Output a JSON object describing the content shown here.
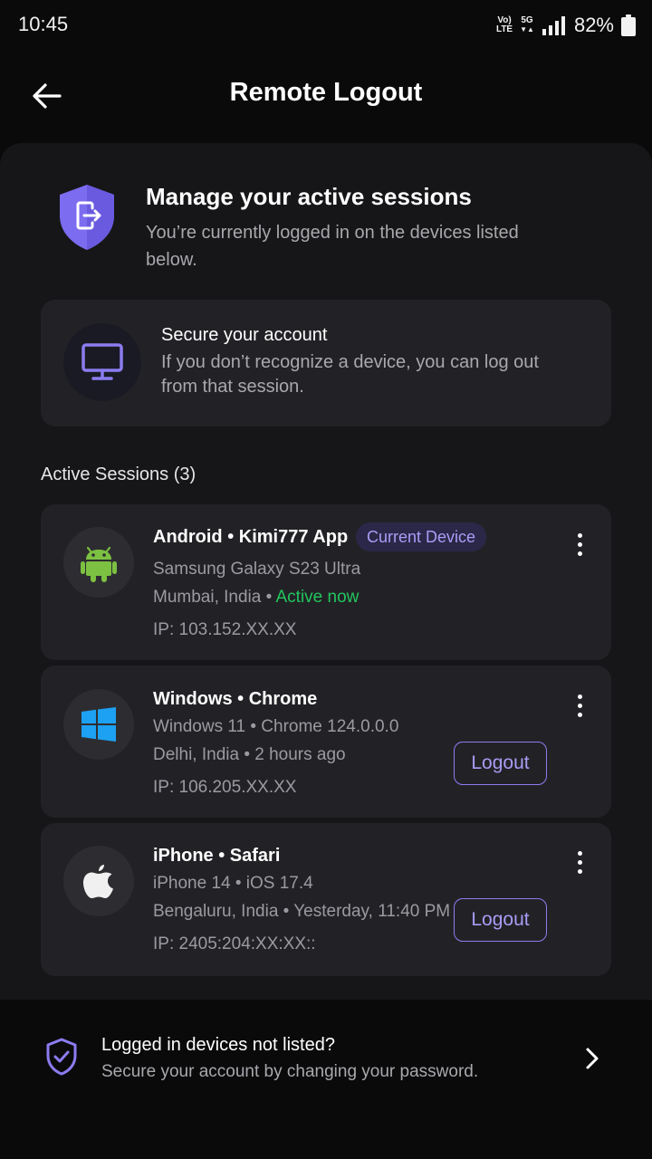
{
  "status_bar": {
    "time": "10:45",
    "volte_top": "Vo)",
    "volte_bottom": "LTE",
    "network": "5G",
    "battery": "82%"
  },
  "header": {
    "title": "Remote Logout"
  },
  "intro": {
    "title": "Manage your active sessions",
    "subtitle": "You’re currently logged in on the devices listed below."
  },
  "secure_card": {
    "title": "Secure your account",
    "text": "If you don’t recognize a device, you can log out from that session."
  },
  "sessions_label": "Active Sessions (3)",
  "sessions": [
    {
      "title": "Android • Kimi777 App",
      "badge": "Current Device",
      "device": "Samsung Galaxy S23 Ultra",
      "location": "Mumbai, India • ",
      "status": "Active now",
      "ip": "IP: 103.152.XX.XX",
      "icon": "android-icon"
    },
    {
      "title": "Windows • Chrome",
      "device": "Windows 11 • Chrome 124.0.0.0",
      "location": "Delhi, India • 2 hours ago",
      "ip": "IP: 106.205.XX.XX",
      "logout": "Logout",
      "icon": "windows-icon"
    },
    {
      "title": "iPhone • Safari",
      "device": "iPhone 14 • iOS 17.4",
      "location": "Bengaluru, India • Yesterday, 11:40 PM",
      "ip": "IP: 2405:204:XX:XX::",
      "logout": "Logout",
      "icon": "apple-icon"
    }
  ],
  "footer": {
    "title": "Logged in devices not listed?",
    "subtitle": "Secure your account by changing your password."
  },
  "colors": {
    "accent": "#8b7cf0",
    "active": "#22c55e",
    "background": "#0a0a0b",
    "card": "#222226"
  }
}
